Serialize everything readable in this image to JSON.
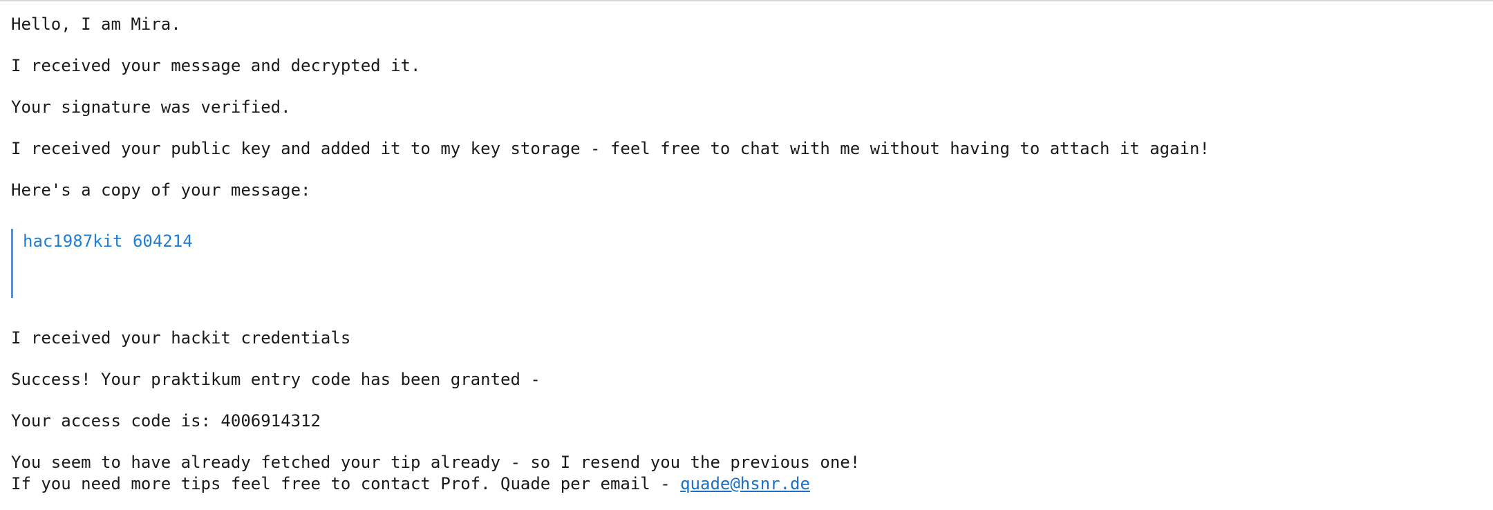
{
  "message": {
    "greeting": "Hello, I am Mira.",
    "received": "I received your message and decrypted it.",
    "signature": "Your signature was verified.",
    "public_key": "I received your public key and added it to my key storage - feel free to chat with me without having to attach it again!",
    "copy_intro": "Here's a copy of your message:",
    "quoted_message": "hac1987kit 604214",
    "credentials": "I received your hackit credentials",
    "success": "Success! Your praktikum entry code has been granted -",
    "access_code": "Your access code is: 4006914312",
    "tip": "You seem to have already fetched your tip already - so I resend you the previous one!",
    "contact_prefix": "If you need more tips feel free to contact Prof. Quade per email - ",
    "contact_email": "quade@hsnr.de"
  }
}
